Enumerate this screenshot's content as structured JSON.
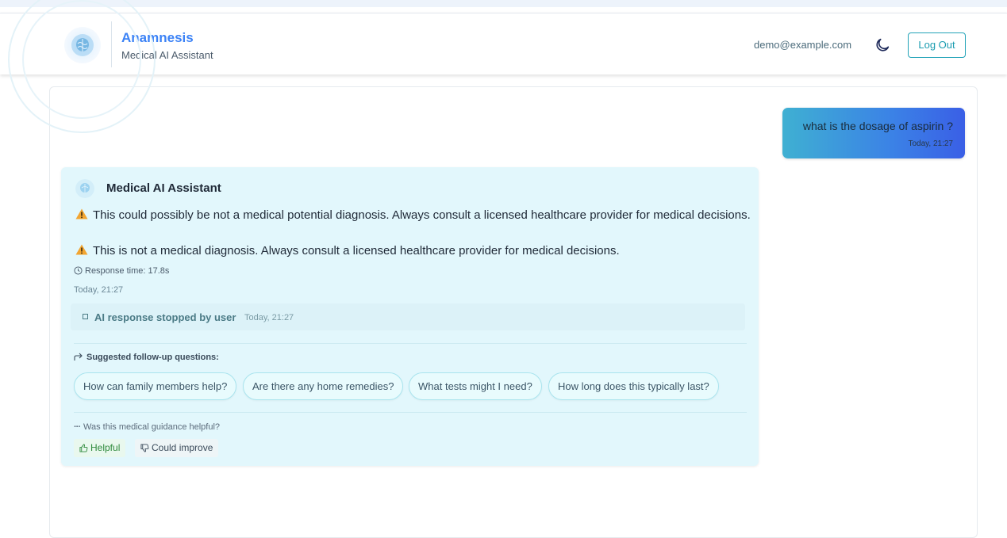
{
  "header": {
    "app_name": "Anamnesis",
    "app_subtitle": "Medical AI Assistant",
    "user_email": "demo@example.com",
    "logout_label": "Log Out",
    "theme_icon": "moon-icon"
  },
  "conversation": {
    "user_message": {
      "text": "what is the dosage of aspirin ?",
      "timestamp": "Today, 21:27"
    },
    "ai_message": {
      "sender": "Medical AI Assistant",
      "warnings": [
        "This could possibly be not a medical potential diagnosis. Always consult a licensed healthcare provider for medical decisions.",
        "This is not a medical diagnosis. Always consult a licensed healthcare provider for medical decisions."
      ],
      "response_time": "Response time: 17.8s",
      "timestamp": "Today, 21:27",
      "stopped_label": "AI response stopped by user",
      "stopped_time": "Today, 21:27",
      "suggested_heading": "Suggested follow-up questions:",
      "suggestions": [
        "How can family members help?",
        "Are there any home remedies?",
        "What tests might I need?",
        "How long does this typically last?"
      ],
      "feedback_question": "Was this medical guidance helpful?",
      "feedback_helpful": "Helpful",
      "feedback_improve": "Could improve"
    }
  },
  "colors": {
    "brand": "#3b82f6",
    "accent": "#1a9cb0",
    "ai_card_bg": "#e2f7fc",
    "user_bubble_start": "#3fb0d2",
    "user_bubble_end": "#3a5fe6"
  }
}
